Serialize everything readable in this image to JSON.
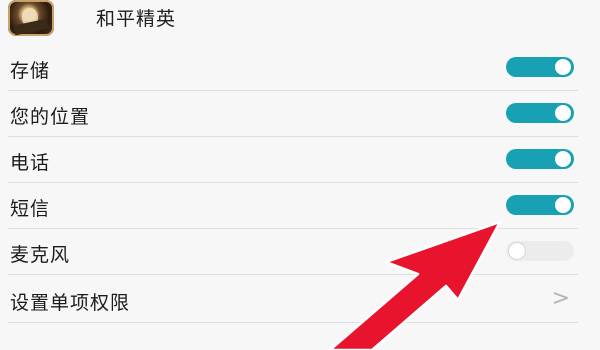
{
  "app": {
    "name": "和平精英",
    "icon": "game-app-icon"
  },
  "permissions": [
    {
      "label": "存储",
      "enabled": true
    },
    {
      "label": "您的位置",
      "enabled": true
    },
    {
      "label": "电话",
      "enabled": true
    },
    {
      "label": "短信",
      "enabled": true
    },
    {
      "label": "麦克风",
      "enabled": false
    }
  ],
  "settings_link": {
    "label": "设置单项权限",
    "icon": "chevron-right-icon",
    "glyph": ">"
  },
  "colors": {
    "toggle_on": "#17a1b3",
    "toggle_off": "#ececec",
    "annotation_arrow": "#e8132c"
  },
  "annotation": {
    "icon": "red-arrow-icon"
  }
}
